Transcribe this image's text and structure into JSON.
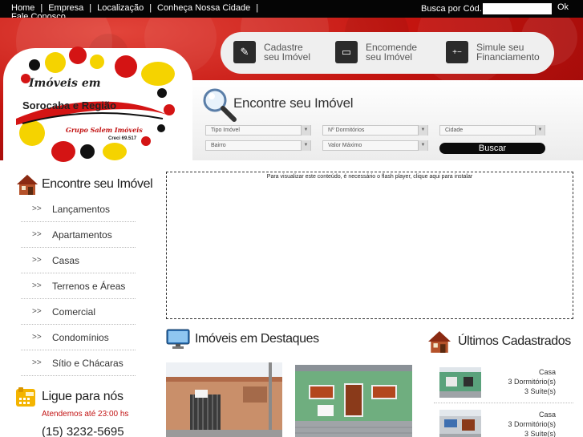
{
  "topnav": {
    "items": [
      "Home",
      "Empresa",
      "Localização",
      "Conheça Nossa Cidade"
    ],
    "fale": "Fale Conosco",
    "busca_label": "Busca por Cód.",
    "busca_value": "",
    "ok_label": "Ok"
  },
  "features": {
    "cadastre": [
      "Cadastre",
      "seu Imóvel"
    ],
    "encomende": [
      "Encomende",
      "seu Imóvel"
    ],
    "simule": [
      "Simule seu",
      "Financiamento"
    ]
  },
  "logo": {
    "line1": "Imóveis em",
    "line2": "Sorocaba e Região",
    "sub": "Grupo Salem Imóveis",
    "creci": "Creci 69.517"
  },
  "search": {
    "title": "Encontre seu Imóvel",
    "fields": {
      "tipo": "Tipo Imóvel",
      "dormitorios": "Nº Dormitórios",
      "cidade": "Cidade",
      "bairro": "Bairro",
      "valor": "Valor Máximo"
    },
    "button": "Buscar"
  },
  "sidebar": {
    "title": "Encontre seu Imóvel",
    "arrow": ">>",
    "items": [
      "Lançamentos",
      "Apartamentos",
      "Casas",
      "Terrenos e Áreas",
      "Comercial",
      "Condomínios",
      "Sítio e Chácaras"
    ],
    "ligue_title": "Ligue para nós",
    "atendemos": "Atendemos até 23:00 hs",
    "phone": "(15) 3232-5695"
  },
  "flash": {
    "message": "Para visualizar este conteúdo, é necessário o flash player, clique aqui para instalar"
  },
  "destaques": {
    "title": "Imóveis em Destaques"
  },
  "ultimos": {
    "title": "Últimos Cadastrados",
    "items": [
      {
        "tipo": "Casa",
        "dorm": "3 Dormitório(s)",
        "suite": "3 Suíte(s)"
      },
      {
        "tipo": "Casa",
        "dorm": "3 Dormitório(s)",
        "suite": "3 Suíte(s)"
      }
    ]
  },
  "colors": {
    "brand_red": "#c4140f",
    "black": "#0b0b0b",
    "accent_yellow": "#f5d300"
  }
}
